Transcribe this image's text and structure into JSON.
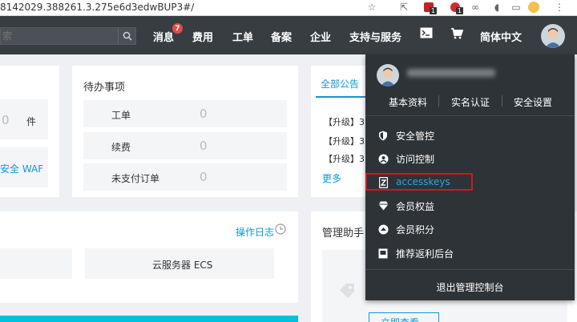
{
  "browser": {
    "url_fragment": "8142029.388261.3.275e6d3edwBUP3#/",
    "ext_badges": [
      "1",
      "1"
    ]
  },
  "topnav": {
    "search_placeholder": "索",
    "messages_label": "消息",
    "messages_count": "7",
    "items": [
      "费用",
      "工单",
      "备案",
      "企业",
      "支持与服务"
    ],
    "language_label": "简体中文"
  },
  "card_left": {
    "value": "0",
    "unit": "件",
    "waf_link": "安全 WAF"
  },
  "todo": {
    "title": "待办事项",
    "rows": [
      {
        "label": "工单",
        "value": "0"
      },
      {
        "label": "续费",
        "value": "0"
      },
      {
        "label": "未支付订单",
        "value": "0"
      }
    ]
  },
  "announcements": {
    "tab_label": "全部公告",
    "items": [
      "【升级】3",
      "【升级】3",
      "【升级】3"
    ],
    "more_label": "更多"
  },
  "ops": {
    "log_link": "操作日志",
    "ecs_label": "云服务器 ECS"
  },
  "manager": {
    "title": "管理助手",
    "view_now": "立即查看"
  },
  "dropdown": {
    "sub_links": [
      "基本资料",
      "实名认证",
      "安全设置"
    ],
    "items": [
      {
        "label": "安全管控",
        "icon": "shield-icon"
      },
      {
        "label": "访问控制",
        "icon": "user-circle-icon"
      },
      {
        "label": "accesskeys",
        "icon": "key-icon"
      },
      {
        "label": "会员权益",
        "icon": "diamond-icon"
      },
      {
        "label": "会员积分",
        "icon": "points-icon"
      },
      {
        "label": "推荐返利后台",
        "icon": "gift-icon"
      }
    ],
    "logout_label": "退出管理控制台",
    "highlight_color": "#d0171d"
  },
  "colors": {
    "nav_bg": "#373d41",
    "accent": "#0a9ad4",
    "dropdown_bg": "#2e3337"
  }
}
